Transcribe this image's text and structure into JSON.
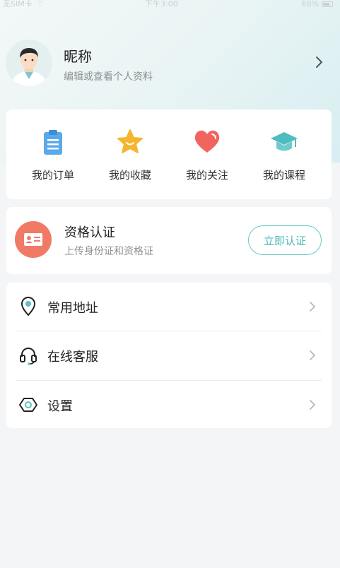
{
  "status_bar": {
    "carrier": "无SIM卡",
    "time": "下午3:00",
    "battery": "68%"
  },
  "profile": {
    "nickname": "昵称",
    "subtitle": "编辑或查看个人资料"
  },
  "quick_actions": [
    {
      "label": "我的订单",
      "icon": "clipboard-icon",
      "color": "#5aa9ea"
    },
    {
      "label": "我的收藏",
      "icon": "star-icon",
      "color": "#f5b52e"
    },
    {
      "label": "我的关注",
      "icon": "heart-icon",
      "color": "#f0665f"
    },
    {
      "label": "我的课程",
      "icon": "graduation-cap-icon",
      "color": "#4fbdbd"
    }
  ],
  "certification": {
    "title": "资格认证",
    "subtitle": "上传身份证和资格证",
    "button": "立即认证",
    "icon_color": "#f07a66",
    "accent": "#69c7c5"
  },
  "menu": [
    {
      "label": "常用地址",
      "icon": "location-pin-icon"
    },
    {
      "label": "在线客服",
      "icon": "headset-icon"
    },
    {
      "label": "设置",
      "icon": "settings-hexagon-icon"
    }
  ]
}
